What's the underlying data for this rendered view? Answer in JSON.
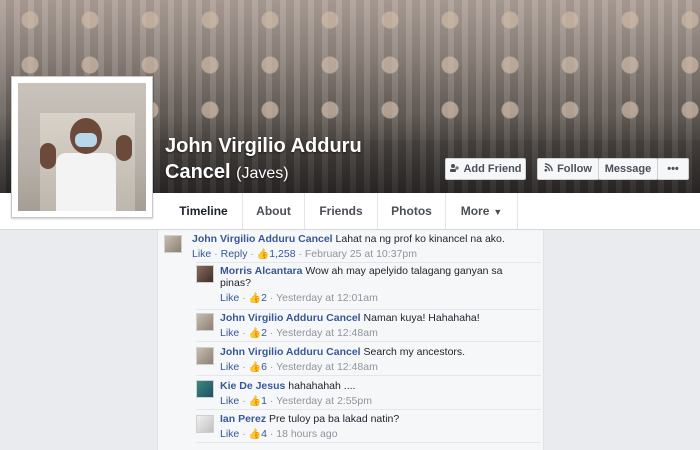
{
  "profile": {
    "name": "John Virgilio Adduru",
    "name_line2": "Cancel",
    "nickname": "(Javes)"
  },
  "actions": {
    "add_friend": "Add Friend",
    "follow": "Follow",
    "message": "Message",
    "more": "•••"
  },
  "tabs": [
    {
      "label": "Timeline"
    },
    {
      "label": "About"
    },
    {
      "label": "Friends"
    },
    {
      "label": "Photos"
    },
    {
      "label": "More"
    }
  ],
  "comments": [
    {
      "author": "John Virgilio Adduru Cancel",
      "text": "Lahat na ng prof ko kinancel na ako.",
      "like": "Like",
      "reply": "Reply",
      "count": "1,258",
      "time": "February 25 at 10:37pm"
    },
    {
      "author": "Morris Alcantara",
      "text": "Wow ah may apelyido talagang ganyan sa",
      "text2": "pinas?",
      "like": "Like",
      "count": "2",
      "time": "Yesterday at 12:01am"
    },
    {
      "author": "John Virgilio Adduru Cancel",
      "text": "Naman kuya! Hahahaha!",
      "like": "Like",
      "count": "2",
      "time": "Yesterday at 12:48am"
    },
    {
      "author": "John Virgilio Adduru Cancel",
      "text": "Search my ancestors.",
      "like": "Like",
      "count": "6",
      "time": "Yesterday at 12:48am"
    },
    {
      "author": "Kie De Jesus",
      "text": "hahahahah ....",
      "like": "Like",
      "count": "1",
      "time": "Yesterday at 2:55pm"
    },
    {
      "author": "Ian Perez",
      "text": "Pre tuloy pa ba lakad natin?",
      "like": "Like",
      "count": "4",
      "time": "18 hours ago"
    }
  ],
  "icons": {
    "add_friend": "add-person-icon",
    "follow": "rss-icon",
    "like": "thumbs-up-icon",
    "caret": "caret-down-icon"
  }
}
